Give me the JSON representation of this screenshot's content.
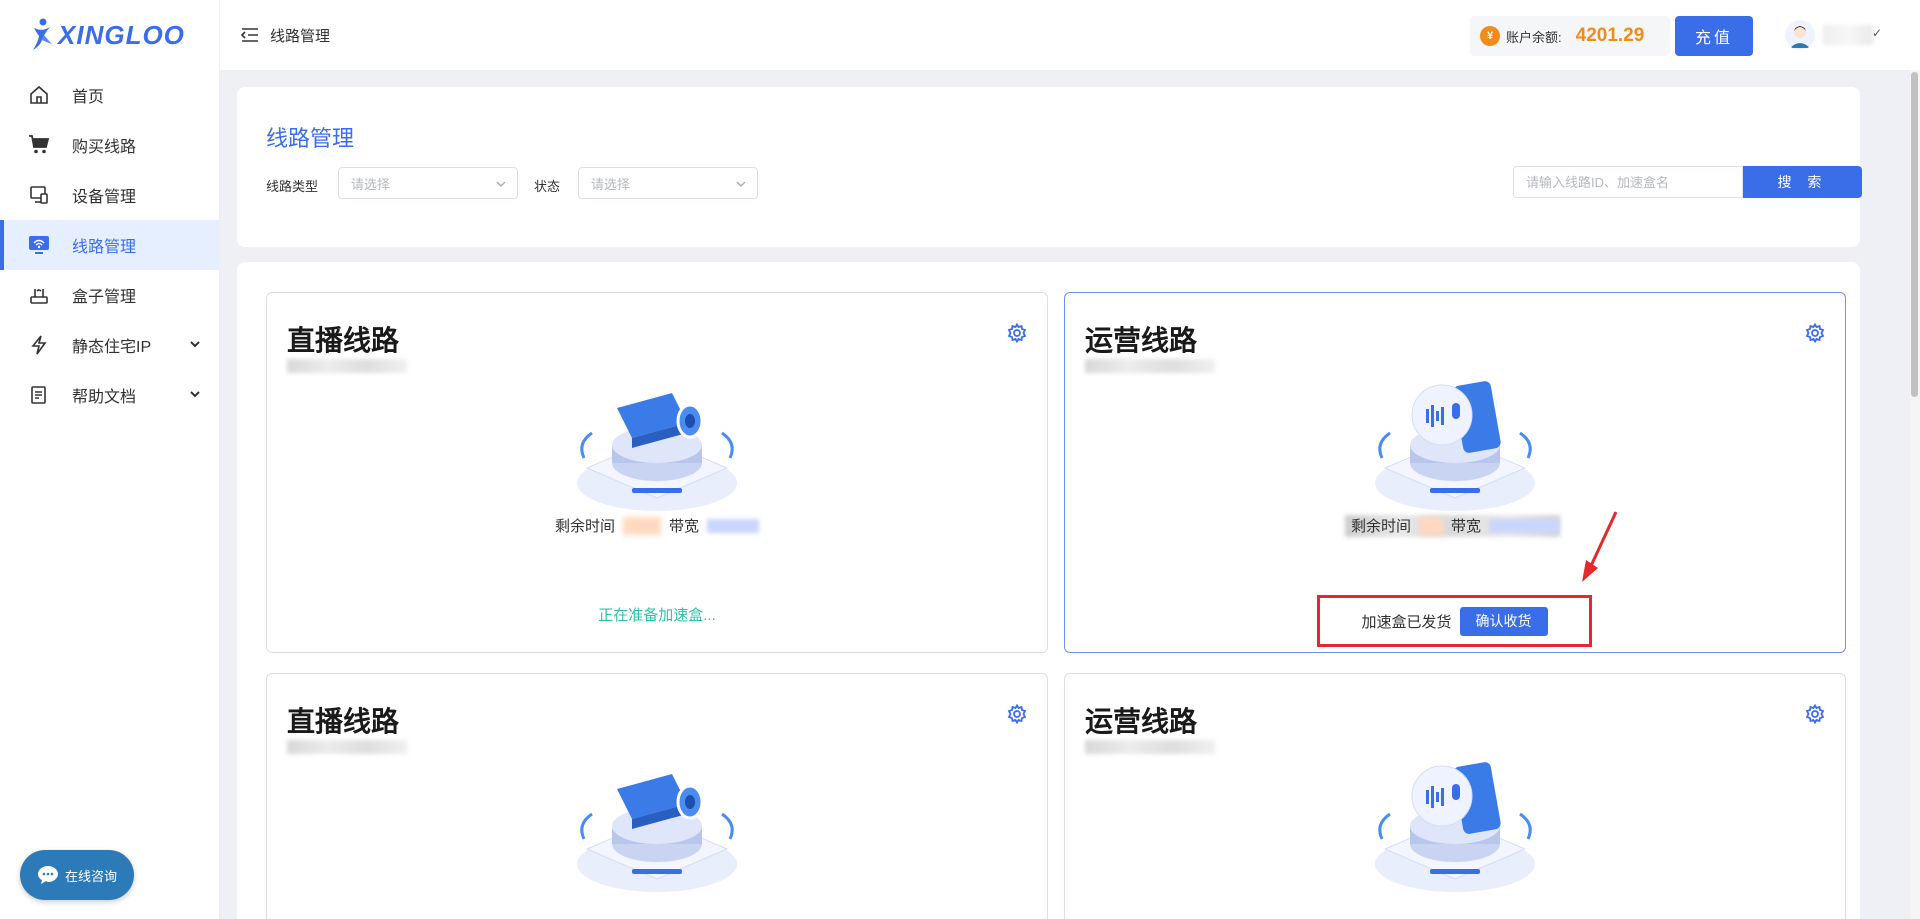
{
  "app": {
    "brand": "XINGLOO"
  },
  "sidebar": {
    "items": [
      {
        "label": "首页",
        "icon": "home-icon"
      },
      {
        "label": "购买线路",
        "icon": "cart-icon"
      },
      {
        "label": "设备管理",
        "icon": "device-icon"
      },
      {
        "label": "线路管理",
        "icon": "monitor-icon",
        "active": true
      },
      {
        "label": "盒子管理",
        "icon": "router-icon"
      },
      {
        "label": "静态住宅IP",
        "icon": "lightning-icon",
        "expandable": true
      },
      {
        "label": "帮助文档",
        "icon": "document-icon",
        "expandable": true
      }
    ],
    "chat_label": "在线咨询"
  },
  "header": {
    "title": "线路管理",
    "balance_label": "账户余额:",
    "balance_value": "4201.29",
    "recharge_label": "充值",
    "coin_symbol": "¥"
  },
  "filters": {
    "page_title": "线路管理",
    "type_label": "线路类型",
    "type_placeholder": "请选择",
    "status_label": "状态",
    "status_placeholder": "请选择",
    "search_placeholder": "请输入线路ID、加速盒名",
    "search_button": "搜 索"
  },
  "cards": [
    {
      "title": "直播线路",
      "kind": "live",
      "remaining_label": "剩余时间",
      "bandwidth_label": "带宽",
      "status": "正在准备加速盒..."
    },
    {
      "title": "运营线路",
      "kind": "ops",
      "remaining_label": "剩余时间",
      "bandwidth_label": "带宽",
      "ship_status": "加速盒已发货",
      "confirm_label": "确认收货"
    },
    {
      "title": "直播线路",
      "kind": "live"
    },
    {
      "title": "运营线路",
      "kind": "ops"
    }
  ],
  "colors": {
    "accent": "#3a6ee8",
    "balance": "#f08c1a",
    "status_green": "#2cc4a8",
    "highlight_red": "#e4292d"
  }
}
